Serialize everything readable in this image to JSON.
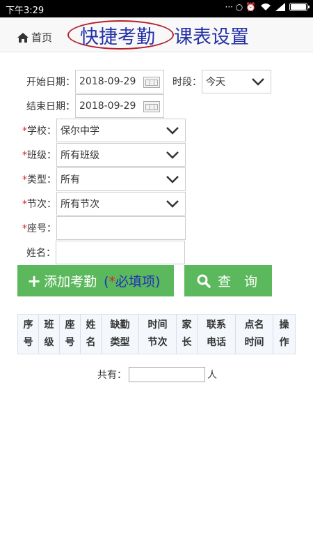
{
  "status_bar": {
    "time": "下午3:29",
    "icons_text": "··· ○ ⏰",
    "battery_percent": 100
  },
  "nav": {
    "home_label": "首页",
    "tab_active": "快捷考勤",
    "tab_second": "课表设置"
  },
  "form": {
    "start_date_label": "开始日期：",
    "start_date_value": "2018-09-29",
    "end_date_label": "结束日期：",
    "end_date_value": "2018-09-29",
    "period_label": "时段：",
    "period_value": "今天",
    "required_mark": "*",
    "school_label": "学校：",
    "school_value": "保尔中学",
    "class_label": "班级：",
    "class_value": "所有班级",
    "type_label": "类型：",
    "type_value": "所有",
    "section_label": "节次：",
    "section_value": "所有节次",
    "seat_label": "座号：",
    "seat_value": "",
    "name_label": "姓名：",
    "name_value": ""
  },
  "buttons": {
    "add_label": "添加考勤",
    "required_note_open": "(",
    "required_note_star": "*",
    "required_note_text": "必填项)",
    "query_label": "查　询"
  },
  "table": {
    "headers": [
      [
        "序",
        "号"
      ],
      [
        "班",
        "级"
      ],
      [
        "座",
        "号"
      ],
      [
        "姓",
        "名"
      ],
      [
        "缺勤",
        "类型"
      ],
      [
        "时间",
        "节次"
      ],
      [
        "家",
        "长"
      ],
      [
        "联系",
        "电话"
      ],
      [
        "点名",
        "时间"
      ],
      [
        "操",
        "作"
      ]
    ]
  },
  "total": {
    "label": "共有：",
    "unit": "人",
    "value": ""
  }
}
